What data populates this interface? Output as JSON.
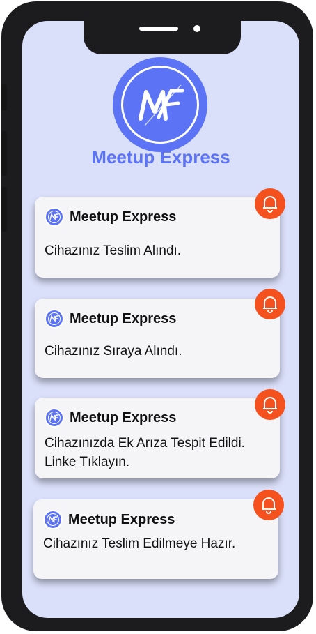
{
  "app": {
    "name": "Meetup Express",
    "logo_text": "ME",
    "accent_color": "#5b73f4",
    "alert_color": "#f4511e"
  },
  "notifications": [
    {
      "title": "Meetup Express",
      "message": "Cihazınız Teslim Alındı.",
      "link": "",
      "icon": "bell-icon"
    },
    {
      "title": "Meetup Express",
      "message": "Cihazınız Sıraya Alındı.",
      "link": "",
      "icon": "bell-icon"
    },
    {
      "title": "Meetup Express",
      "message": "Cihazınızda Ek Arıza Tespit Edildi.",
      "link": "Linke Tıklayın.",
      "icon": "bell-icon"
    },
    {
      "title": "Meetup Express",
      "message": "Cihazınız Teslim Edilmeye Hazır.",
      "link": "",
      "icon": "bell-icon"
    }
  ]
}
